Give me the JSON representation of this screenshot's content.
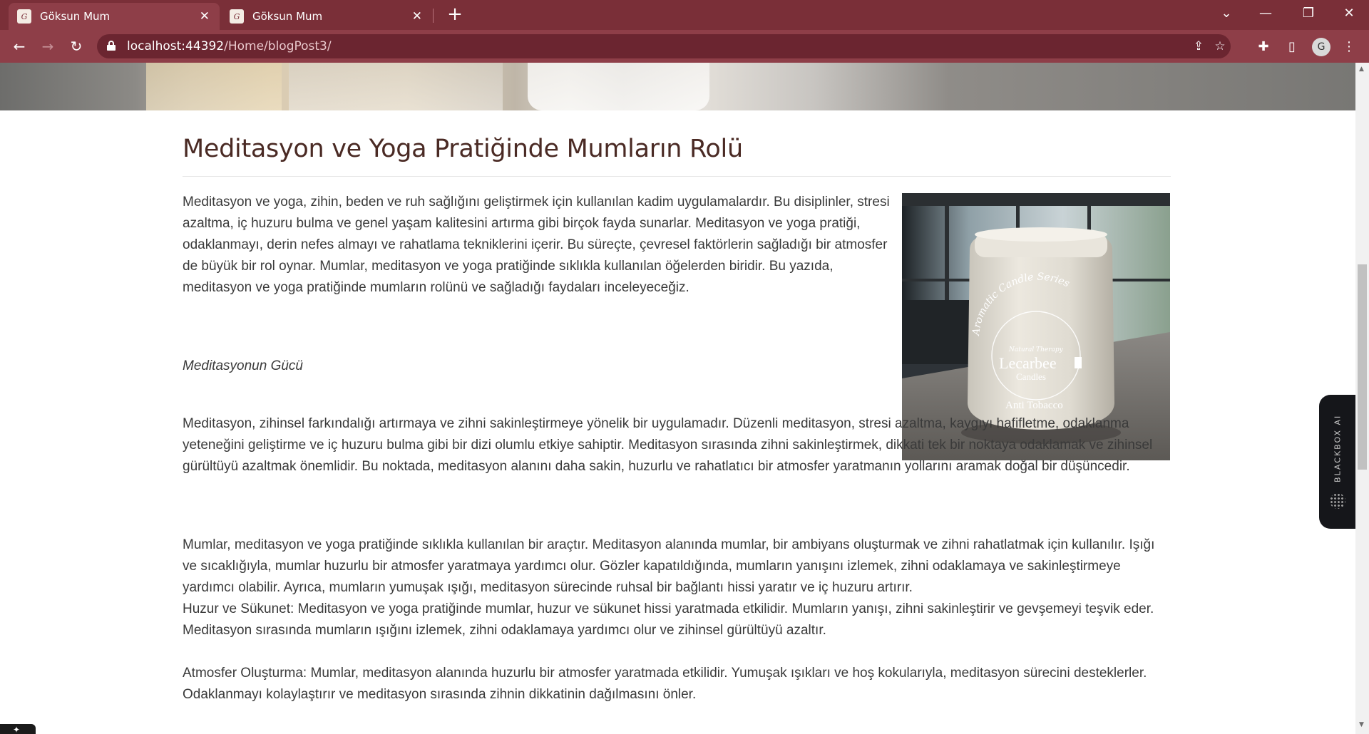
{
  "browser": {
    "tabs": [
      {
        "title": "Göksun Mum",
        "active": true
      },
      {
        "title": "Göksun Mum",
        "active": false
      }
    ],
    "url_host": "localhost:44392",
    "url_path": "/Home/blogPost3/",
    "profile_initial": "G"
  },
  "article": {
    "title": "Meditasyon ve Yoga Pratiğinde Mumların Rolü",
    "intro": "Meditasyon ve yoga, zihin, beden ve ruh sağlığını geliştirmek için kullanılan kadim uygulamalardır. Bu disiplinler, stresi azaltma, iç huzuru bulma ve genel yaşam kalitesini artırma gibi birçok fayda sunarlar. Meditasyon ve yoga pratiği, odaklanmayı, derin nefes almayı ve rahatlama tekniklerini içerir. Bu süreçte, çevresel faktörlerin sağladığı bir atmosfer de büyük bir rol oynar. Mumlar, meditasyon ve yoga pratiğinde sıklıkla kullanılan öğelerden biridir. Bu yazıda, meditasyon ve yoga pratiğinde mumların rolünü ve sağladığı faydaları inceleyeceğiz.",
    "subheading": "Meditasyonun Gücü",
    "para2": "Meditasyon, zihinsel farkındalığı artırmaya ve zihni sakinleştirmeye yönelik bir uygulamadır. Düzenli meditasyon, stresi azaltma, kaygıyı hafifletme, odaklanma yeteneğini geliştirme ve iç huzuru bulma gibi bir dizi olumlu etkiye sahiptir. Meditasyon sırasında zihni sakinleştirmek, dikkati tek bir noktaya odaklamak ve zihinsel gürültüyü azaltmak önemlidir. Bu noktada, meditasyon alanını daha sakin, huzurlu ve rahatlatıcı bir atmosfer yaratmanın yollarını aramak doğal bir düşüncedir.",
    "para3": "Mumlar, meditasyon ve yoga pratiğinde sıklıkla kullanılan bir araçtır. Meditasyon alanında mumlar, bir ambiyans oluşturmak ve zihni rahatlatmak için kullanılır. Işığı ve sıcaklığıyla, mumlar huzurlu bir atmosfer yaratmaya yardımcı olur. Gözler kapatıldığında, mumların yanışını izlemek, zihni odaklamaya ve sakinleştirmeye yardımcı olabilir. Ayrıca, mumların yumuşak ışığı, meditasyon sürecinde ruhsal bir bağlantı hissi yaratır ve iç huzuru artırır.",
    "para4": "Huzur ve Sükunet: Meditasyon ve yoga pratiğinde mumlar, huzur ve sükunet hissi yaratmada etkilidir. Mumların yanışı, zihni sakinleştirir ve gevşemeyi teşvik eder. Meditasyon sırasında mumların ışığını izlemek, zihni odaklamaya yardımcı olur ve zihinsel gürültüyü azaltır.",
    "para5": "Atmosfer Oluşturma: Mumlar, meditasyon alanında huzurlu bir atmosfer yaratmada etkilidir. Yumuşak ışıkları ve hoş kokularıyla, meditasyon sürecini desteklerler. Odaklanmayı kolaylaştırır ve meditasyon sırasında zihnin dikkatinin dağılmasını önler.",
    "image": {
      "arc_text": "Aromatic Candle Series",
      "small_text": "Natural Therapy",
      "brand": "Lecarbee",
      "brand_sub": "Candles",
      "product": "Anti Tobacco"
    }
  },
  "extension": {
    "label": "BLACKBOX AI"
  },
  "colors": {
    "tab_bar": "#7a2f38",
    "toolbar": "#8e3e48",
    "title": "#4a2a24",
    "text": "#3a3a3a"
  }
}
